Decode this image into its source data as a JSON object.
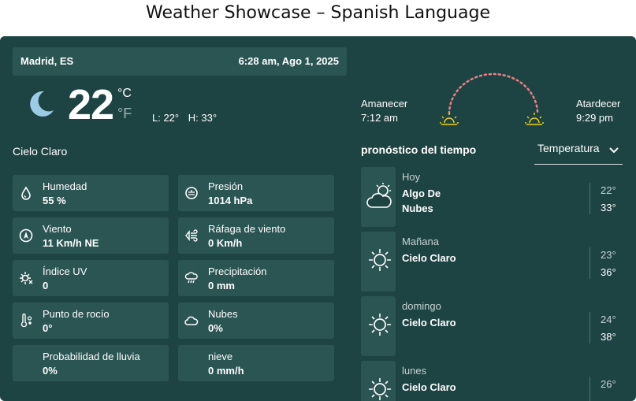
{
  "page_title": "Weather Showcase – Spanish Language",
  "current": {
    "location": "Madrid, ES",
    "datetime": "6:28 am, Ago 1, 2025",
    "icon": "moon-icon",
    "temperature": "22",
    "unit_c": "°C",
    "unit_f": "°F",
    "low": "L: 22°",
    "high": "H: 33°",
    "condition": "Cielo Claro"
  },
  "details": [
    {
      "icon": "humidity-icon",
      "label": "Humedad",
      "value": "55 %"
    },
    {
      "icon": "pressure-icon",
      "label": "Presión",
      "value": "1014 hPa"
    },
    {
      "icon": "wind-icon",
      "label": "Viento",
      "value": "11 Km/h NE"
    },
    {
      "icon": "wind-gust-icon",
      "label": "Ráfaga de viento",
      "value": "0 Km/h"
    },
    {
      "icon": "uv-index-icon",
      "label": "Índice UV",
      "value": "0"
    },
    {
      "icon": "precipitation-icon",
      "label": "Precipitación",
      "value": "0 mm"
    },
    {
      "icon": "dew-point-icon",
      "label": "Punto de rocío",
      "value": "0°"
    },
    {
      "icon": "clouds-icon",
      "label": "Nubes",
      "value": "0%"
    },
    {
      "icon": "",
      "label": "Probabilidad de lluvia",
      "value": "0%"
    },
    {
      "icon": "",
      "label": "nieve",
      "value": "0 mm/h"
    }
  ],
  "sun": {
    "sunrise_label": "Amanecer",
    "sunrise_time": "7:12 am",
    "sunset_label": "Atardecer",
    "sunset_time": "9:29 pm"
  },
  "forecast": {
    "title": "pronóstico del tiempo",
    "dropdown_value": "Temperatura",
    "days": [
      {
        "day": "Hoy",
        "condition": "Algo De Nubes",
        "icon": "partly-cloudy-icon",
        "temp_top": "22°",
        "temp_bottom": "33°"
      },
      {
        "day": "Mañana",
        "condition": "Cielo Claro",
        "icon": "sun-icon",
        "temp_top": "23°",
        "temp_bottom": "36°"
      },
      {
        "day": "domingo",
        "condition": "Cielo Claro",
        "icon": "sun-icon",
        "temp_top": "24°",
        "temp_bottom": "38°"
      },
      {
        "day": "lunes",
        "condition": "Cielo Claro",
        "icon": "sun-icon",
        "temp_top": "26°",
        "temp_bottom": ""
      }
    ]
  },
  "colors": {
    "card_bg": "#1d4443",
    "tile_bg": "#2a5553",
    "arc": "#f07f86",
    "sun_marker": "#f2d21a"
  }
}
